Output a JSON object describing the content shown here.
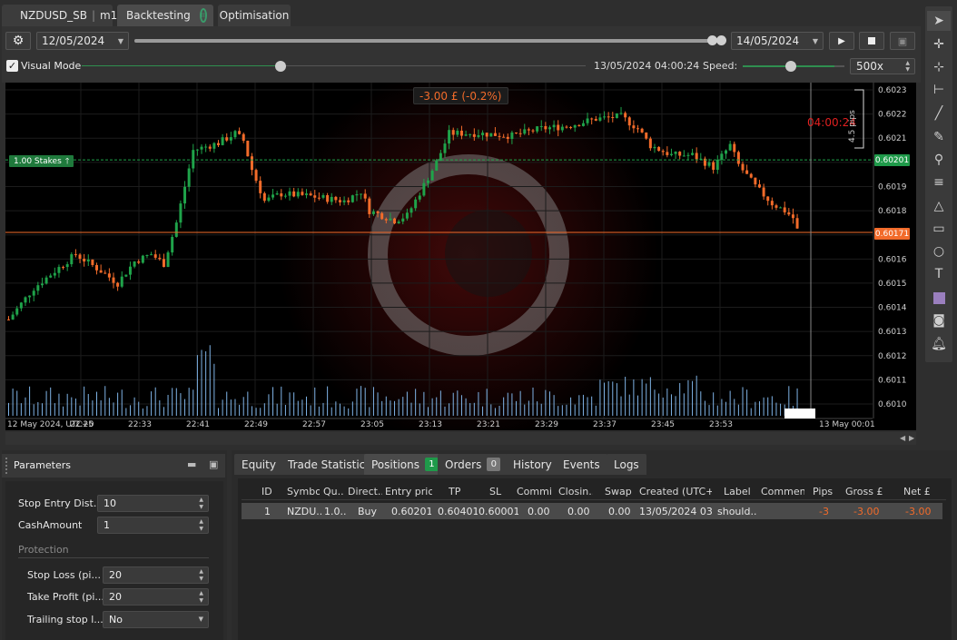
{
  "tabs": {
    "symbol": "NZDUSD_SB",
    "timeframe": "m1",
    "backtesting": "Backtesting",
    "optimisation": "Optimisation"
  },
  "toolbar": {
    "start_date": "12/05/2024",
    "end_date": "14/05/2024",
    "visual_mode": "Visual Mode",
    "current_time": "13/05/2024 04:00:24",
    "speed_label": "Speed:",
    "speed_value": "500x",
    "progress_fraction": 1.0,
    "speed_fraction": 0.9
  },
  "chart": {
    "pnl": "-3.00 £ (-0.2%)",
    "stakes_label": "1.00 Stakes",
    "stakes_price": "0.60201",
    "current_price": "0.60171",
    "countdown": "04:00:24",
    "range_label": "4.5 pips",
    "price_ticks": [
      "0.6023",
      "0.6022",
      "0.6021",
      "0.6020",
      "0.6019",
      "0.6018",
      "0.6017",
      "0.6016",
      "0.6015",
      "0.6014",
      "0.6013",
      "0.6012",
      "0.6011",
      "0.6010"
    ],
    "time_ticks": [
      "12 May 2024, UTC+0",
      "22:25",
      "22:33",
      "22:41",
      "22:49",
      "22:57",
      "23:05",
      "23:13",
      "23:21",
      "23:29",
      "23:37",
      "23:45",
      "23:53",
      "13 May 00:01"
    ],
    "colors": {
      "up": "#1fa34a",
      "down": "#f26b2a",
      "volume": "#7fb3e6",
      "stakes_line": "#1fa34a",
      "price_line": "#f26b2a"
    }
  },
  "right_toolbar": [
    "cursor-icon",
    "crosshair-icon",
    "zoom-icon",
    "measure-icon",
    "trend-line-icon",
    "pen-icon",
    "pin-icon",
    "rectangle-icon",
    "ellipse-icon",
    "text-icon",
    "color-square-icon",
    "camera-icon",
    "alert-bell-icon"
  ],
  "parameters": {
    "title": "Parameters",
    "rows": [
      {
        "label": "Stop Entry Dist...",
        "value": "10",
        "type": "number"
      },
      {
        "label": "CashAmount",
        "value": "1",
        "type": "number"
      }
    ],
    "section": "Protection",
    "protection_rows": [
      {
        "label": "Stop Loss (pi...",
        "value": "20",
        "type": "number"
      },
      {
        "label": "Take Profit (pi...",
        "value": "20",
        "type": "number"
      },
      {
        "label": "Trailing stop l...",
        "value": "No",
        "type": "select"
      }
    ]
  },
  "bottom_tabs": {
    "equity": "Equity",
    "trade_stats": "Trade Statistics",
    "positions": "Positions",
    "positions_count": "1",
    "orders": "Orders",
    "orders_count": "0",
    "history": "History",
    "events": "Events",
    "logs": "Logs"
  },
  "positions_table": {
    "headers": [
      "ID",
      "Symbo",
      "Qu...",
      "Direct...",
      "Entry price",
      "TP",
      "SL",
      "Commi...",
      "Closin...",
      "Swap",
      "Created (UTC+0",
      "Label",
      "Comment",
      "Pips",
      "Gross £",
      "Net £"
    ],
    "rows": [
      [
        "1",
        "NZDU...",
        "1.0...",
        "Buy",
        "0.60201",
        "0.60401",
        "0.60001",
        "0.00",
        "0.00",
        "0.00",
        "13/05/2024 03:...",
        "should...",
        "",
        "-3",
        "-3.00",
        "-3.00"
      ]
    ]
  }
}
